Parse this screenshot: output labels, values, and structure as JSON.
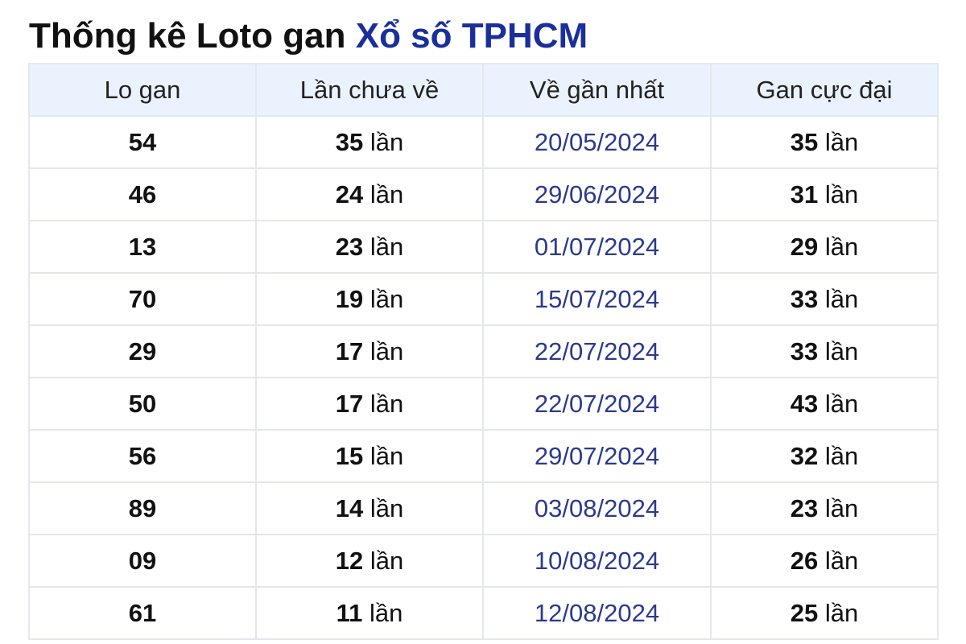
{
  "heading": {
    "prefix": "Thống kê Loto gan ",
    "accent": "Xổ số TPHCM"
  },
  "table": {
    "columns": [
      "Lo gan",
      "Lần chưa về",
      "Về gần nhất",
      "Gan cực đại"
    ],
    "unit": "lần",
    "rows": [
      {
        "lo": "54",
        "chua_ve": "35",
        "gan_nhat": "20/05/2024",
        "cuc_dai": "35"
      },
      {
        "lo": "46",
        "chua_ve": "24",
        "gan_nhat": "29/06/2024",
        "cuc_dai": "31"
      },
      {
        "lo": "13",
        "chua_ve": "23",
        "gan_nhat": "01/07/2024",
        "cuc_dai": "29"
      },
      {
        "lo": "70",
        "chua_ve": "19",
        "gan_nhat": "15/07/2024",
        "cuc_dai": "33"
      },
      {
        "lo": "29",
        "chua_ve": "17",
        "gan_nhat": "22/07/2024",
        "cuc_dai": "33"
      },
      {
        "lo": "50",
        "chua_ve": "17",
        "gan_nhat": "22/07/2024",
        "cuc_dai": "43"
      },
      {
        "lo": "56",
        "chua_ve": "15",
        "gan_nhat": "29/07/2024",
        "cuc_dai": "32"
      },
      {
        "lo": "89",
        "chua_ve": "14",
        "gan_nhat": "03/08/2024",
        "cuc_dai": "23"
      },
      {
        "lo": "09",
        "chua_ve": "12",
        "gan_nhat": "10/08/2024",
        "cuc_dai": "26"
      },
      {
        "lo": "61",
        "chua_ve": "11",
        "gan_nhat": "12/08/2024",
        "cuc_dai": "25"
      }
    ]
  },
  "colors": {
    "accent": "#1a2f9a",
    "date_text": "#2b3a8e",
    "header_bg": "#eaf3fd",
    "border": "#e4e7ec"
  }
}
